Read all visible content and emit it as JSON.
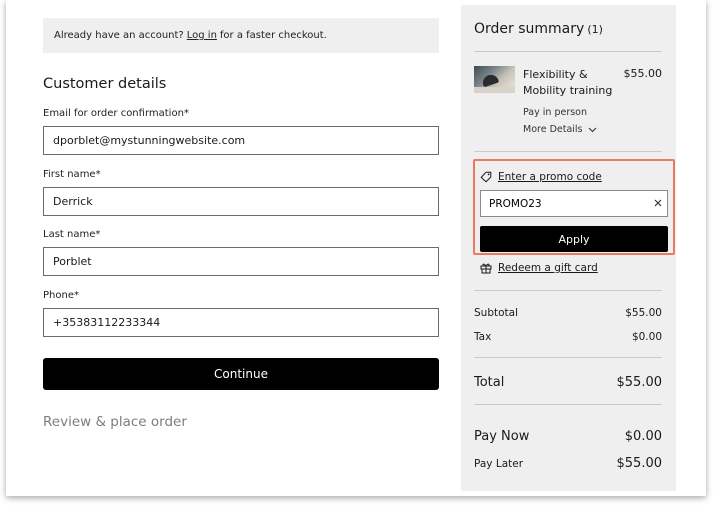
{
  "login_banner": {
    "prefix": "Already have an account?",
    "link": "Log in",
    "suffix": "for a faster checkout."
  },
  "customer": {
    "title": "Customer details",
    "email": {
      "label": "Email for order confirmation*",
      "value": "dporblet@mystunningwebsite.com"
    },
    "first_name": {
      "label": "First name*",
      "value": "Derrick"
    },
    "last_name": {
      "label": "Last name*",
      "value": "Porblet"
    },
    "phone": {
      "label": "Phone*",
      "value": "+35383112233344"
    },
    "continue_label": "Continue",
    "review_title": "Review & place order"
  },
  "summary": {
    "title": "Order summary",
    "count": "(1)",
    "item": {
      "thumbnail_icon": "product-photo",
      "name": "Flexibility & Mobility training",
      "price": "$55.00",
      "payment": "Pay in person",
      "more_details": "More Details"
    },
    "promo": {
      "link_label": "Enter a promo code",
      "value": "PROMO23",
      "apply_label": "Apply",
      "highlight_color": "#f07664"
    },
    "gift_card_label": "Redeem a gift card",
    "subtotal": {
      "label": "Subtotal",
      "value": "$55.00"
    },
    "tax": {
      "label": "Tax",
      "value": "$0.00"
    },
    "total": {
      "label": "Total",
      "value": "$55.00"
    },
    "pay_now": {
      "label": "Pay Now",
      "value": "$0.00"
    },
    "pay_later": {
      "label": "Pay Later",
      "value": "$55.00"
    }
  }
}
